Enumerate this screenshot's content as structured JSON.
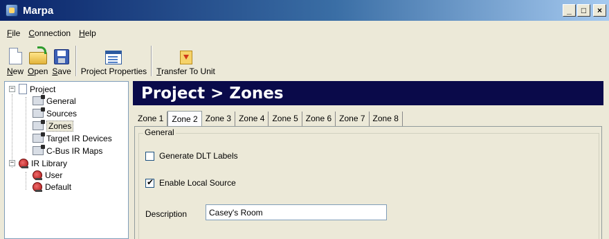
{
  "window": {
    "title": "Marpa"
  },
  "window_controls": {
    "minimize": "_",
    "maximize": "□",
    "close": "×"
  },
  "menu": [
    {
      "label": "File",
      "ul": "F",
      "rest": "ile"
    },
    {
      "label": "Connection",
      "ul": "C",
      "rest": "onnection"
    },
    {
      "label": "Help",
      "ul": "H",
      "rest": "elp"
    }
  ],
  "toolbar": {
    "new": {
      "ul": "N",
      "rest": "ew"
    },
    "open": {
      "ul": "O",
      "rest": "pen"
    },
    "save": {
      "ul": "S",
      "rest": "ave"
    },
    "project_properties": {
      "pre": "Pro",
      "ul": "j",
      "rest": "ect Properties"
    },
    "transfer": {
      "ul": "T",
      "rest": "ransfer To Unit"
    }
  },
  "tree": {
    "project": {
      "label": "Project",
      "expander": "−"
    },
    "general": "General",
    "sources": "Sources",
    "zones": "Zones",
    "target_ir": "Target IR Devices",
    "cbus_ir": "C-Bus IR Maps",
    "ir_library": {
      "label": "IR Library",
      "expander": "−"
    },
    "user": "User",
    "default": "Default"
  },
  "main": {
    "banner": "Project > Zones",
    "tabs": [
      "Zone 1",
      "Zone 2",
      "Zone 3",
      "Zone 4",
      "Zone 5",
      "Zone 6",
      "Zone 7",
      "Zone 8"
    ],
    "active_tab": "Zone 2",
    "group_title": "General",
    "generate_dlt": {
      "label": "Generate DLT Labels",
      "checked": false
    },
    "enable_local": {
      "label": "Enable Local Source",
      "checked": true
    },
    "description": {
      "label": "Description",
      "value": "Casey's Room"
    }
  },
  "colors": {
    "title_bar": "#0a246a",
    "banner_bg": "#0a0a4a",
    "window_bg": "#ece9d8"
  }
}
